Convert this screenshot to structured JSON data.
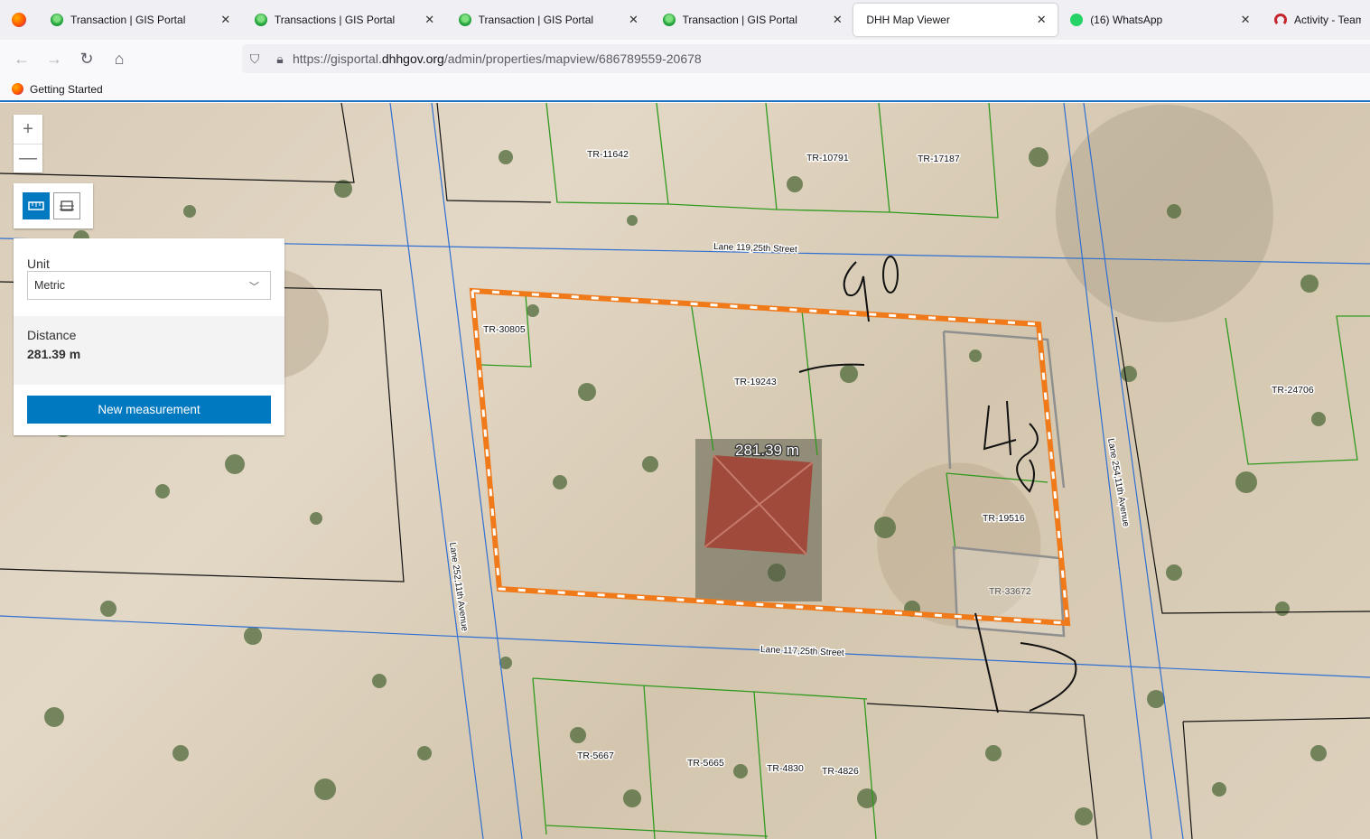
{
  "tabs": [
    {
      "title": "Transaction | GIS Portal",
      "icon": "gis-icon"
    },
    {
      "title": "Transactions | GIS Portal",
      "icon": "gis-icon"
    },
    {
      "title": "Transaction | GIS Portal",
      "icon": "gis-icon"
    },
    {
      "title": "Transaction | GIS Portal",
      "icon": "gis-icon"
    },
    {
      "title": "DHH Map Viewer",
      "icon": "none"
    },
    {
      "title": "(16) WhatsApp",
      "icon": "whatsapp-icon"
    },
    {
      "title": "Activity - Teams P",
      "icon": "teams-icon"
    }
  ],
  "active_tab": 4,
  "address": {
    "prefix": "https://gisportal.",
    "host": "dhhgov.org",
    "path": "/admin/properties/mapview/686789559-20678"
  },
  "bookmarks": {
    "getting_started": "Getting Started"
  },
  "map": {
    "zoom_in": "+",
    "zoom_out": "—",
    "measure_panel": {
      "unit_label": "Unit",
      "unit_value": "Metric",
      "distance_label": "Distance",
      "distance_value": "281.39 m",
      "new_button": "New measurement"
    },
    "measure_overlay_label": "281.39 m",
    "parcels": [
      "TR-11642",
      "TR-10791",
      "TR-17187",
      "TR-30805",
      "TR-19243",
      "TR-24706",
      "TR-19516",
      "TR-33672",
      "TR-5667",
      "TR-5665",
      "TR-4830",
      "TR-4826"
    ],
    "streets": [
      "Lane 119,25th Street",
      "Lane 252,11th Avenue",
      "Lane 254,11th Avenue",
      "Lane 117,25th Street"
    ],
    "handwritten": [
      "40",
      "48",
      "15"
    ]
  },
  "colors": {
    "measure_line": "#f07a1a",
    "accent": "#0079c1",
    "road_line": "#2f6fd1",
    "parcel_green": "#2f9a1f"
  }
}
